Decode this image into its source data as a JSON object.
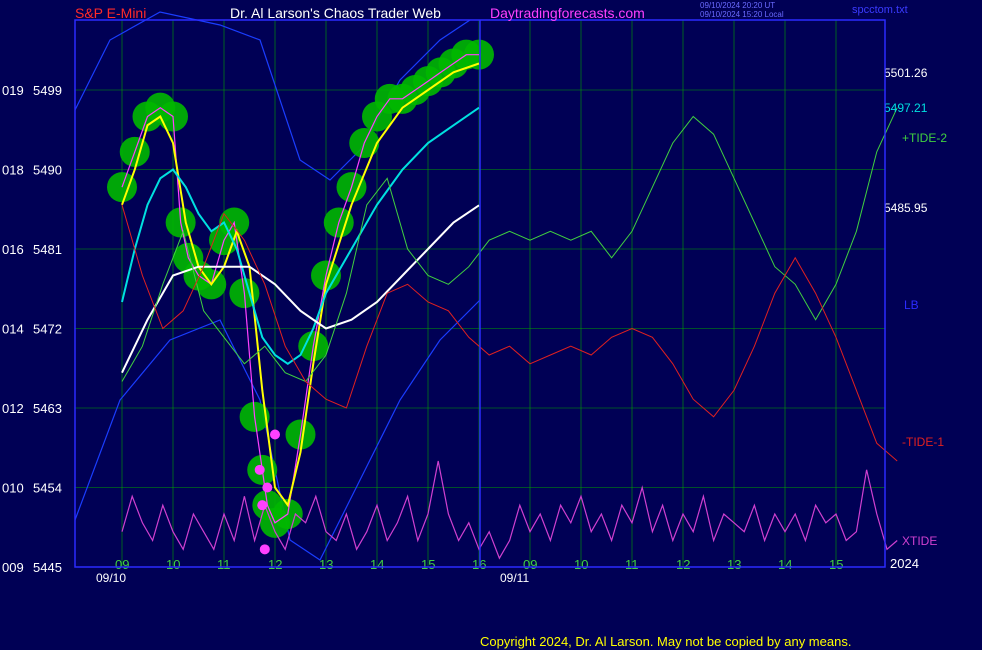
{
  "header": {
    "symbol": "S&P E-Mini",
    "title": "Dr. Al Larson's Chaos Trader Web",
    "site": "Daytradingforecasts.com",
    "timestamp_ut": "09/10/2024 20:20 UT",
    "timestamp_local": "09/10/2024 15:20 Local",
    "filename": "spcctom.txt"
  },
  "copyright": "Copyright 2024, Dr. Al Larson. May not be copied by any means.",
  "colors": {
    "background": "#000055",
    "plot_border": "#2b2bff",
    "grid": "#00a000",
    "price": "#ff40ff",
    "yellow_ma": "#ffff00",
    "cyan_ma": "#00e0e0",
    "white_ma": "#ffffff",
    "tide2": "#40d040",
    "tide1": "#e02020",
    "xtide": "#d040d0",
    "bands": "#1a3dff",
    "blobs": "#00b800"
  },
  "chart_data": {
    "type": "line",
    "title": "S&P E-Mini",
    "y_ticks": [
      {
        "left": "019",
        "value": 5499
      },
      {
        "left": "018",
        "value": 5490
      },
      {
        "left": "016",
        "value": 5481
      },
      {
        "left": "014",
        "value": 5472
      },
      {
        "left": "012",
        "value": 5463
      },
      {
        "left": "010",
        "value": 5454
      },
      {
        "left": "009",
        "value": 5445
      }
    ],
    "ylim": [
      5445,
      5505
    ],
    "x_ticks": [
      "09",
      "10",
      "11",
      "12",
      "13",
      "14",
      "15",
      "16",
      "09",
      "10",
      "11",
      "12",
      "13",
      "14",
      "15",
      "16"
    ],
    "x_dates": [
      "09/10",
      "09/11"
    ],
    "year_label": "2024",
    "grid": true,
    "right_labels": [
      {
        "text": "5501.26",
        "color": "#ffffff"
      },
      {
        "text": "5497.21",
        "color": "#00e0e0"
      },
      {
        "text": "+TIDE-2",
        "color": "#40d040"
      },
      {
        "text": "5485.95",
        "color": "#ffffff"
      },
      {
        "text": "LB",
        "color": "#2b2bff"
      },
      {
        "text": "-TIDE-1",
        "color": "#e02020"
      },
      {
        "text": "XTIDE",
        "color": "#d040d0"
      }
    ],
    "series": [
      {
        "name": "Price",
        "x": [
          9.0,
          9.25,
          9.5,
          9.75,
          10.0,
          10.15,
          10.3,
          10.5,
          10.75,
          11.0,
          11.2,
          11.4,
          11.6,
          11.75,
          11.85,
          12.0,
          12.25,
          12.5,
          12.75,
          13.0,
          13.25,
          13.5,
          13.75,
          14.0,
          14.25,
          14.5,
          14.75,
          15.0,
          15.25,
          15.5,
          15.75,
          16.0
        ],
        "values": [
          5488,
          5492,
          5496,
          5497,
          5496,
          5484,
          5480,
          5478,
          5477,
          5482,
          5484,
          5476,
          5462,
          5456,
          5452,
          5450,
          5451,
          5460,
          5470,
          5478,
          5484,
          5488,
          5493,
          5496,
          5498,
          5498,
          5499,
          5500,
          5501,
          5502,
          5503,
          5503
        ]
      },
      {
        "name": "yellow",
        "x": [
          9.0,
          9.25,
          9.5,
          9.75,
          10.0,
          10.25,
          10.5,
          10.75,
          11.0,
          11.25,
          11.5,
          11.75,
          12.0,
          12.25,
          12.5,
          12.75,
          13.0,
          13.5,
          14.0,
          14.5,
          15.0,
          15.5,
          16.0
        ],
        "values": [
          5486,
          5490,
          5495,
          5496,
          5493,
          5484,
          5479,
          5477,
          5479,
          5483,
          5479,
          5465,
          5454,
          5452,
          5458,
          5468,
          5477,
          5486,
          5493,
          5497,
          5499,
          5501,
          5502
        ]
      },
      {
        "name": "cyan",
        "x": [
          9.0,
          9.25,
          9.5,
          9.75,
          10.0,
          10.25,
          10.5,
          10.75,
          11.0,
          11.25,
          11.5,
          11.75,
          12.0,
          12.25,
          12.5,
          12.75,
          13.0,
          13.5,
          14.0,
          14.5,
          15.0,
          15.5,
          16.0
        ],
        "values": [
          5475,
          5481,
          5486,
          5489,
          5490,
          5488,
          5485,
          5483,
          5484,
          5481,
          5476,
          5471,
          5469,
          5468,
          5469,
          5472,
          5476,
          5481,
          5486,
          5490,
          5493,
          5495,
          5497
        ]
      },
      {
        "name": "white",
        "x": [
          9.0,
          9.5,
          10.0,
          10.5,
          11.0,
          11.5,
          12.0,
          12.5,
          13.0,
          13.5,
          14.0,
          14.5,
          15.0,
          15.5,
          16.0
        ],
        "values": [
          5467,
          5473,
          5478,
          5479,
          5479,
          5479,
          5477,
          5474,
          5472,
          5473,
          5475,
          5478,
          5481,
          5484,
          5485.95
        ]
      },
      {
        "name": "+TIDE-2",
        "x": [
          9.0,
          9.4,
          9.8,
          10.2,
          10.6,
          11.0,
          11.4,
          11.8,
          12.2,
          12.6,
          13.0,
          13.4,
          13.8,
          14.2,
          14.6,
          15.0,
          15.4,
          15.8,
          16.2,
          16.6,
          17.0,
          17.4,
          17.8,
          18.2,
          18.6,
          19.0,
          19.4,
          19.8,
          20.2,
          20.6,
          21.0,
          21.4,
          21.8,
          22.2,
          22.6,
          23.0,
          23.4,
          23.8,
          24.2
        ],
        "values": [
          5466,
          5470,
          5477,
          5483,
          5474,
          5471,
          5468,
          5470,
          5467,
          5466,
          5469,
          5476,
          5486,
          5489,
          5481,
          5478,
          5477,
          5479,
          5482,
          5483,
          5482,
          5483,
          5482,
          5483,
          5480,
          5483,
          5488,
          5493,
          5496,
          5494,
          5489,
          5484,
          5479,
          5477,
          5473,
          5477,
          5483,
          5492,
          5497
        ]
      },
      {
        "name": "-TIDE-1",
        "x": [
          9.0,
          9.4,
          9.8,
          10.2,
          10.6,
          11.0,
          11.4,
          11.8,
          12.2,
          12.6,
          13.0,
          13.4,
          13.8,
          14.2,
          14.6,
          15.0,
          15.4,
          15.8,
          16.2,
          16.6,
          17.0,
          17.4,
          17.8,
          18.2,
          18.6,
          19.0,
          19.4,
          19.8,
          20.2,
          20.6,
          21.0,
          21.4,
          21.8,
          22.2,
          22.6,
          23.0,
          23.4,
          23.8,
          24.2
        ],
        "values": [
          5486,
          5478,
          5472,
          5474,
          5479,
          5485,
          5482,
          5477,
          5470,
          5466,
          5464,
          5463,
          5470,
          5476,
          5477,
          5475,
          5474,
          5471,
          5469,
          5470,
          5468,
          5469,
          5470,
          5469,
          5471,
          5472,
          5471,
          5468,
          5464,
          5462,
          5465,
          5470,
          5476,
          5480,
          5476,
          5471,
          5465,
          5459,
          5457
        ]
      },
      {
        "name": "XTIDE",
        "x": [
          9.0,
          9.2,
          9.4,
          9.6,
          9.8,
          10.0,
          10.2,
          10.4,
          10.6,
          10.8,
          11.0,
          11.2,
          11.4,
          11.6,
          11.8,
          12.0,
          12.2,
          12.4,
          12.6,
          12.8,
          13.0,
          13.2,
          13.4,
          13.6,
          13.8,
          14.0,
          14.2,
          14.4,
          14.6,
          14.8,
          15.0,
          15.2,
          15.4,
          15.6,
          15.8,
          16.0,
          16.2,
          16.4,
          16.6,
          16.8,
          17.0,
          17.2,
          17.4,
          17.6,
          17.8,
          18.0,
          18.2,
          18.4,
          18.6,
          18.8,
          19.0,
          19.2,
          19.4,
          19.6,
          19.8,
          20.0,
          20.2,
          20.4,
          20.6,
          20.8,
          21.0,
          21.2,
          21.4,
          21.6,
          21.8,
          22.0,
          22.2,
          22.4,
          22.6,
          22.8,
          23.0,
          23.2,
          23.4,
          23.6,
          23.8,
          24.0,
          24.2
        ],
        "values": [
          5449,
          5453,
          5450,
          5448,
          5452,
          5449,
          5447,
          5451,
          5449,
          5447,
          5451,
          5448,
          5453,
          5448,
          5452,
          5449,
          5447,
          5451,
          5450,
          5453,
          5449,
          5448,
          5451,
          5447,
          5449,
          5452,
          5448,
          5450,
          5453,
          5448,
          5451,
          5457,
          5451,
          5448,
          5450,
          5447,
          5449,
          5446,
          5448,
          5452,
          5449,
          5451,
          5448,
          5452,
          5450,
          5453,
          5449,
          5451,
          5448,
          5452,
          5450,
          5454,
          5449,
          5452,
          5448,
          5451,
          5449,
          5453,
          5448,
          5451,
          5450,
          5449,
          5452,
          5448,
          5451,
          5449,
          5451,
          5448,
          5452,
          5450,
          5451,
          5448,
          5449,
          5456,
          5451,
          5447,
          5448
        ]
      }
    ]
  }
}
